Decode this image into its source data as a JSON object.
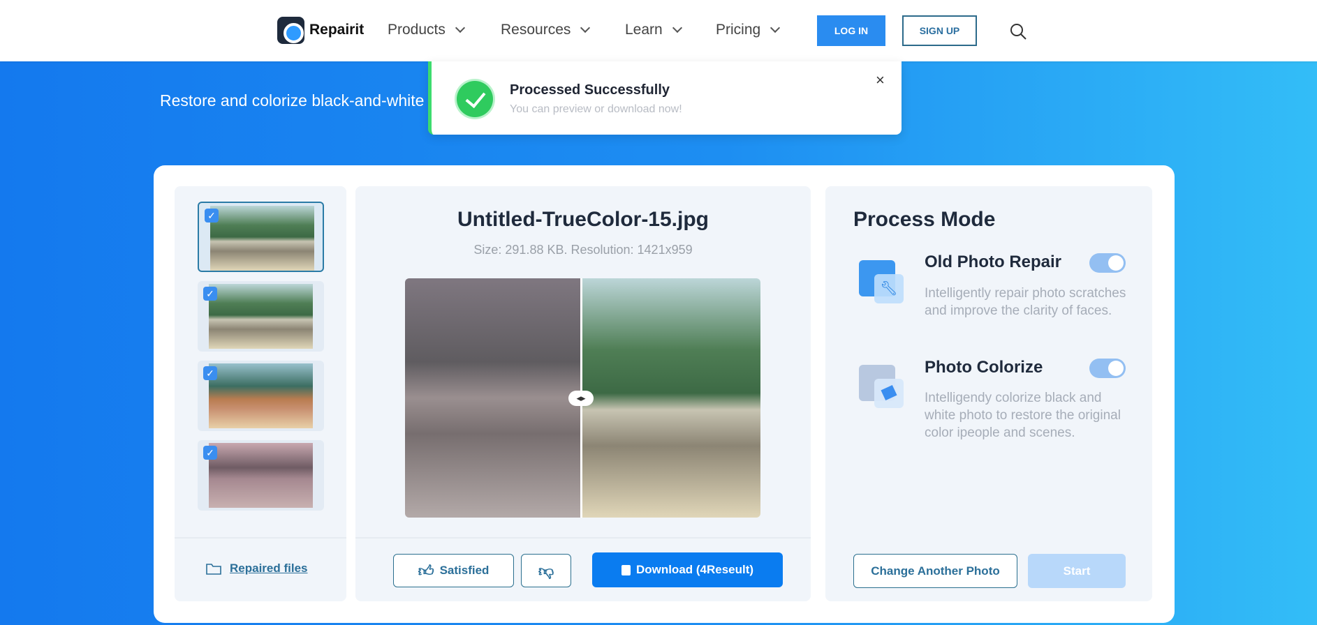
{
  "header": {
    "brand": "Repairit",
    "nav": [
      {
        "label": "Products"
      },
      {
        "label": "Resources"
      },
      {
        "label": "Learn"
      },
      {
        "label": "Pricing"
      }
    ],
    "login": "LOG IN",
    "signup": "SIGN UP"
  },
  "hero": {
    "text": "Restore and colorize black-and-white photos and enjoy the colorful results for"
  },
  "toast": {
    "title": "Processed Successfully",
    "subtitle": "You can preview or download now!",
    "close": "×"
  },
  "thumbnails": [
    {
      "checked": true,
      "selected": true
    },
    {
      "checked": true
    },
    {
      "checked": true
    },
    {
      "checked": true
    }
  ],
  "preview": {
    "filename": "Untitled-TrueColor-15.jpg",
    "info": "Size: 291.88 KB. Resolution: 1421x959"
  },
  "actions": {
    "repaired_files": "Repaired files",
    "satisfied": "Satisfied",
    "download": "Download (4Reseult)"
  },
  "process_mode": {
    "title": "Process Mode",
    "modes": [
      {
        "title": "Old Photo Repair",
        "desc": "Intelligently repair photo scratches and improve the clarity of faces.",
        "enabled": true
      },
      {
        "title": "Photo Colorize",
        "desc": "Intelligendy colorize black and white photo to restore the original color ipeople and scenes.",
        "enabled": true
      }
    ],
    "change": "Change Another Photo",
    "start": "Start"
  },
  "colors": {
    "primary": "#1479ee",
    "success": "#2fcb5e",
    "start_disabled": "#b8d8fa"
  }
}
